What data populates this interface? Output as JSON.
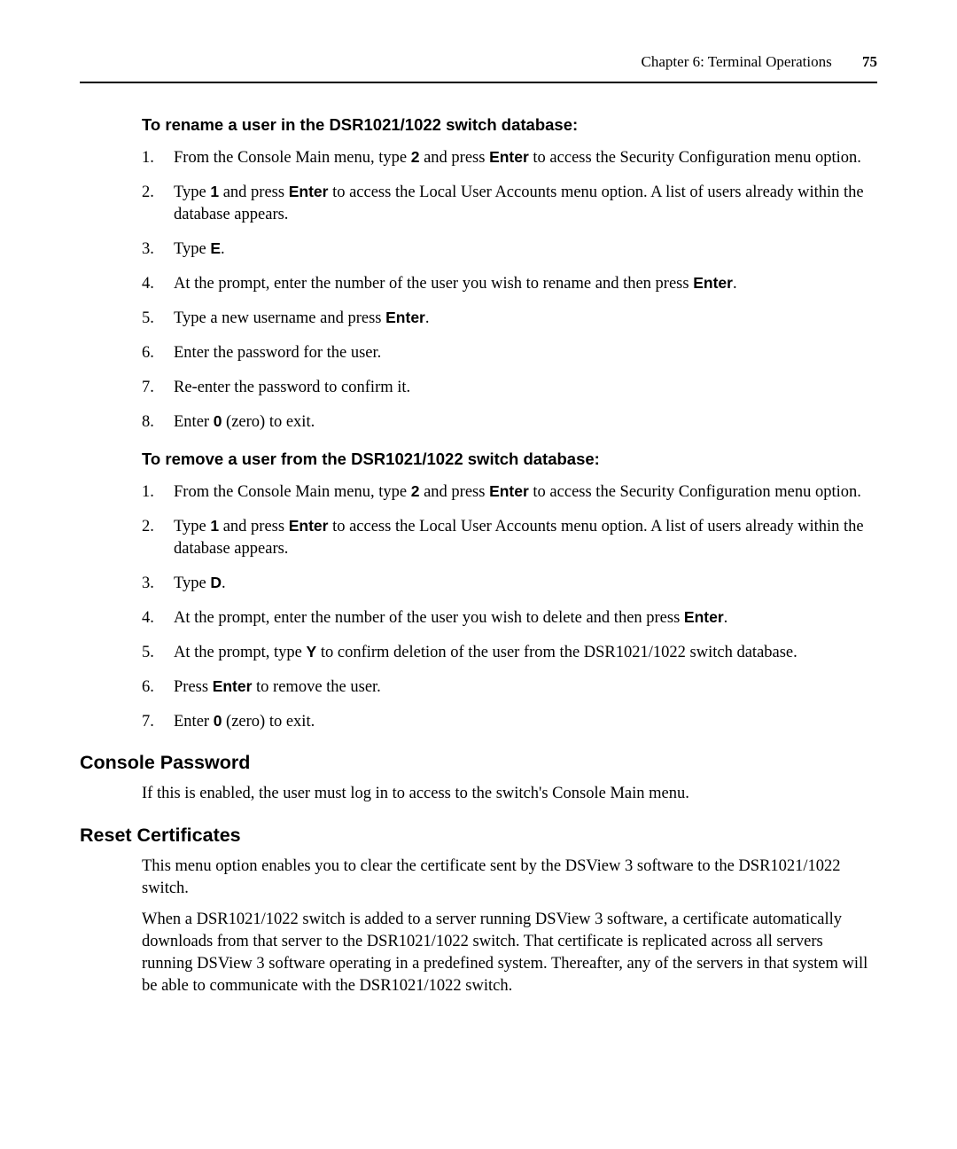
{
  "header": {
    "chapter": "Chapter 6: Terminal Operations",
    "page_number": "75"
  },
  "rename": {
    "title": "To rename a user in the DSR1021/1022 switch database:",
    "steps": {
      "s1_a": "From the Console Main menu, type ",
      "s1_b": "2",
      "s1_c": " and press ",
      "s1_d": "Enter",
      "s1_e": " to access the Security Configuration menu option.",
      "s2_a": "Type ",
      "s2_b": "1",
      "s2_c": " and press ",
      "s2_d": "Enter",
      "s2_e": " to access the Local User Accounts menu option. A list of users already within the database appears.",
      "s3_a": "Type ",
      "s3_b": "E",
      "s3_c": ".",
      "s4_a": "At the prompt, enter the number of the user you wish to rename and then press ",
      "s4_b": "Enter",
      "s4_c": ".",
      "s5_a": "Type a new username and press ",
      "s5_b": "Enter",
      "s5_c": ".",
      "s6": "Enter the password for the user.",
      "s7": "Re-enter the password to confirm it.",
      "s8_a": "Enter ",
      "s8_b": "0",
      "s8_c": " (zero) to exit."
    }
  },
  "remove": {
    "title": "To remove a user from the DSR1021/1022 switch database:",
    "steps": {
      "s1_a": "From the Console Main menu, type ",
      "s1_b": "2",
      "s1_c": " and press ",
      "s1_d": "Enter",
      "s1_e": " to access the Security Configuration menu option.",
      "s2_a": "Type ",
      "s2_b": "1",
      "s2_c": " and press ",
      "s2_d": "Enter",
      "s2_e": " to access the Local User Accounts menu option. A list of users already within the database appears.",
      "s3_a": "Type ",
      "s3_b": "D",
      "s3_c": ".",
      "s4_a": "At the prompt, enter the number of the user you wish to delete and then press ",
      "s4_b": "Enter",
      "s4_c": ".",
      "s5_a": "At the prompt, type ",
      "s5_b": "Y",
      "s5_c": " to confirm deletion of the user from the DSR1021/1022 switch database.",
      "s6_a": "Press ",
      "s6_b": "Enter",
      "s6_c": " to remove the user.",
      "s7_a": "Enter ",
      "s7_b": "0",
      "s7_c": " (zero) to exit."
    }
  },
  "console_password": {
    "title": "Console Password",
    "para": "If this is enabled, the user must log in to access to the switch's Console Main menu."
  },
  "reset_certificates": {
    "title": "Reset Certificates",
    "para1": "This menu option enables you to clear the certificate sent by the DSView 3 software to the DSR1021/1022 switch.",
    "para2": "When a DSR1021/1022 switch is added to a server running DSView 3 software, a certificate automatically downloads from that server to the DSR1021/1022 switch. That certificate is replicated across all servers running DSView 3 software operating in a predefined system. Thereafter, any of the servers in that system will be able to communicate with the DSR1021/1022 switch."
  }
}
